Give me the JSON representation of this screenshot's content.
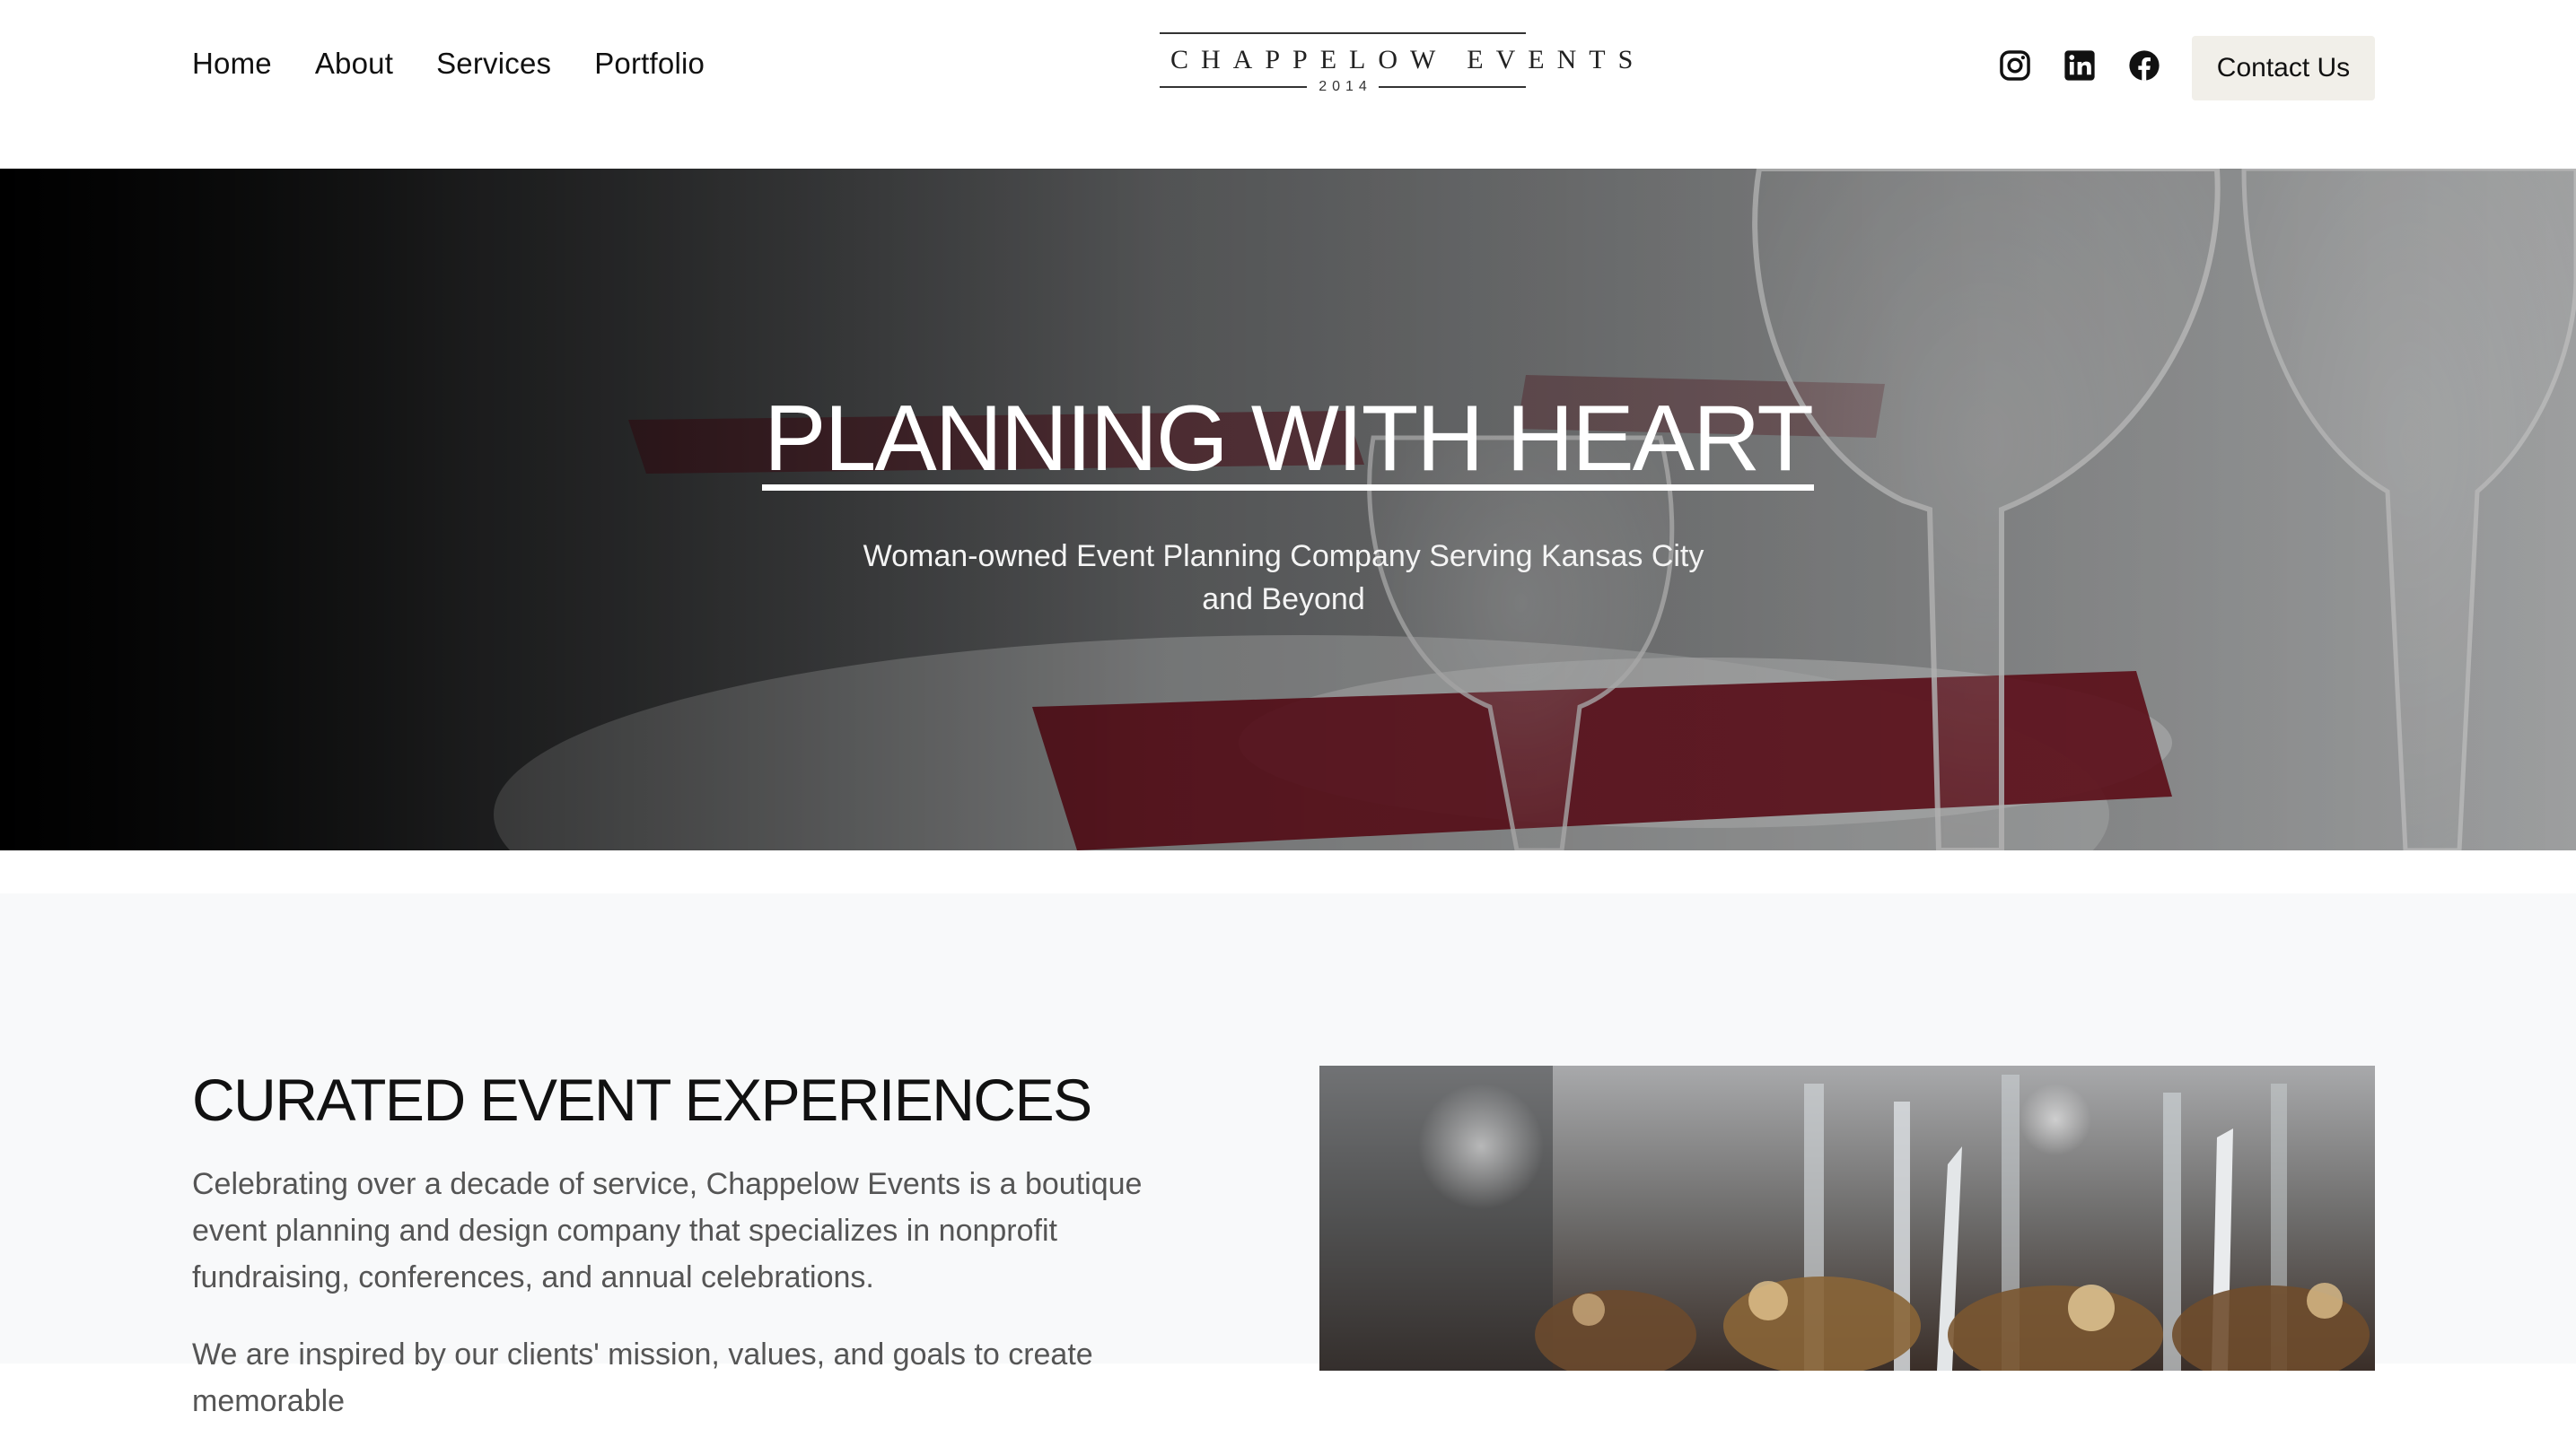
{
  "header": {
    "nav": [
      "Home",
      "About",
      "Services",
      "Portfolio"
    ],
    "logo": {
      "name": "CHAPPELOW EVENTS",
      "year": "2014"
    },
    "social_icons": [
      "instagram-icon",
      "linkedin-icon",
      "facebook-icon"
    ],
    "contact_label": "Contact Us"
  },
  "hero": {
    "title": "PLANNING WITH HEART",
    "subtitle": "Woman-owned Event Planning Company Serving Kansas City and Beyond",
    "image": "table-setting-wine-glasses-red-napkins"
  },
  "section": {
    "title": "CURATED EVENT EXPERIENCES",
    "paragraphs": [
      "Celebrating over a decade of service, Chappelow Events is a boutique event planning and design company that specializes in nonprofit fundraising, conferences, and annual celebrations.",
      "We are inspired by our clients' mission, values, and goals to create memorable"
    ],
    "image": "dessert-skewers-closeup"
  },
  "colors": {
    "button_bg": "#f1efe9",
    "section_bg": "#f8f9fa",
    "napkin_red": "#7a1220"
  }
}
